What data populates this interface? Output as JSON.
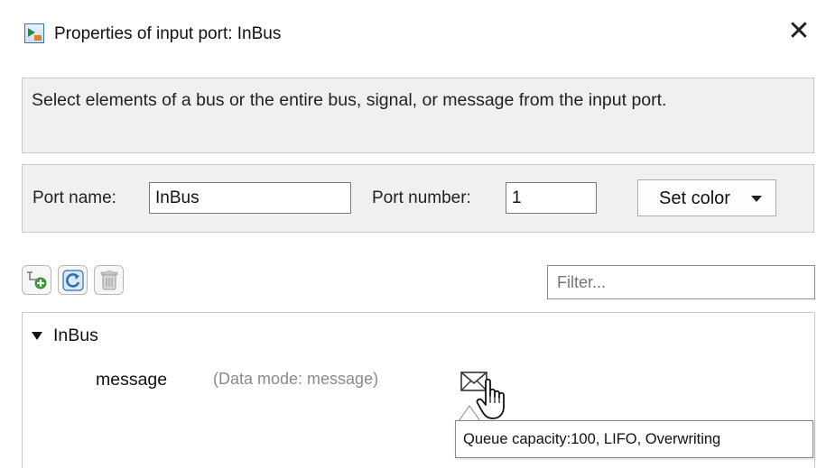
{
  "window": {
    "title": "Properties of input port: InBus",
    "close_glyph": "✕"
  },
  "description": "Select elements of a bus or the entire bus, signal, or message from the input port.",
  "port": {
    "name_label": "Port name:",
    "name_value": "InBus",
    "number_label": "Port number:",
    "number_value": "1",
    "color_button_label": "Set color"
  },
  "toolbar": {
    "icons": [
      "add-element-icon",
      "refresh-icon",
      "delete-icon"
    ],
    "filter_placeholder": "Filter..."
  },
  "tree": {
    "root_label": "InBus",
    "child_label": "message",
    "child_mode": "(Data mode: message)",
    "child_icon": "envelope-icon"
  },
  "tooltip": {
    "text": "Queue capacity:100, LIFO, Overwriting"
  },
  "colors": {
    "panel_bg": "#f0f0f0",
    "border": "#c9c9c9",
    "refresh_blue": "#2f6fb5",
    "add_green": "#3a9a3a"
  }
}
